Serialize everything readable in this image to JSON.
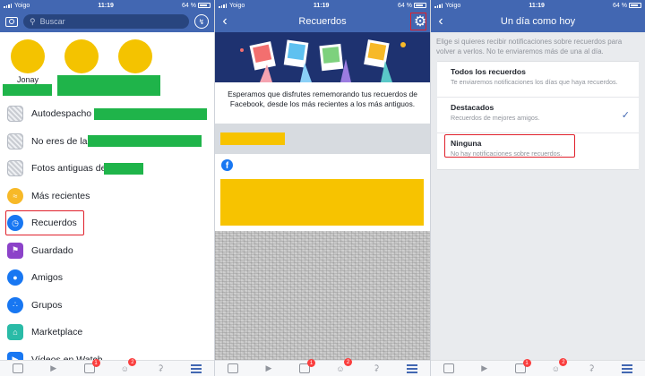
{
  "status": {
    "carrier": "Yoigo",
    "time": "11:19",
    "battery": "64 %"
  },
  "panel1": {
    "search_placeholder": "Buscar",
    "friends": [
      {
        "name": "Jonay"
      },
      {
        "name": ""
      },
      {
        "name": ""
      }
    ],
    "menu": [
      {
        "label": "Autodespacho",
        "icon": "thumbnail-icon"
      },
      {
        "label": "No eres de la",
        "icon": "thumbnail-icon"
      },
      {
        "label": "Fotos antiguas de",
        "icon": "thumbnail-icon"
      },
      {
        "label": "Más recientes",
        "icon": "rss-icon"
      },
      {
        "label": "Recuerdos",
        "icon": "clock-icon"
      },
      {
        "label": "Guardado",
        "icon": "bookmark-icon"
      },
      {
        "label": "Amigos",
        "icon": "friends-icon"
      },
      {
        "label": "Grupos",
        "icon": "groups-icon"
      },
      {
        "label": "Marketplace",
        "icon": "shop-icon"
      },
      {
        "label": "Vídeos en Watch",
        "icon": "video-icon"
      }
    ]
  },
  "panel2": {
    "title": "Recuerdos",
    "intro": "Esperamos que disfrutes rememorando tus recuerdos de Facebook, desde los más recientes a los más antiguos."
  },
  "panel3": {
    "title": "Un día como hoy",
    "description": "Elige si quieres recibir notificaciones sobre recuerdos para volver a verlos. No te enviaremos más de una al día.",
    "options": [
      {
        "title": "Todos los recuerdos",
        "desc": "Te enviaremos notificaciones los días que haya recuerdos.",
        "selected": false
      },
      {
        "title": "Destacados",
        "desc": "Recuerdos de mejores amigos.",
        "selected": true
      },
      {
        "title": "Ninguna",
        "desc": "No hay notificaciones sobre recuerdos.",
        "selected": false
      }
    ]
  },
  "tabbar": {
    "badges": [
      "1",
      "2"
    ]
  },
  "colors": {
    "brand": "#4267b2",
    "highlight": "#e0202b",
    "redacted_green": "#1fb44a",
    "redacted_yellow": "#f7c300"
  }
}
